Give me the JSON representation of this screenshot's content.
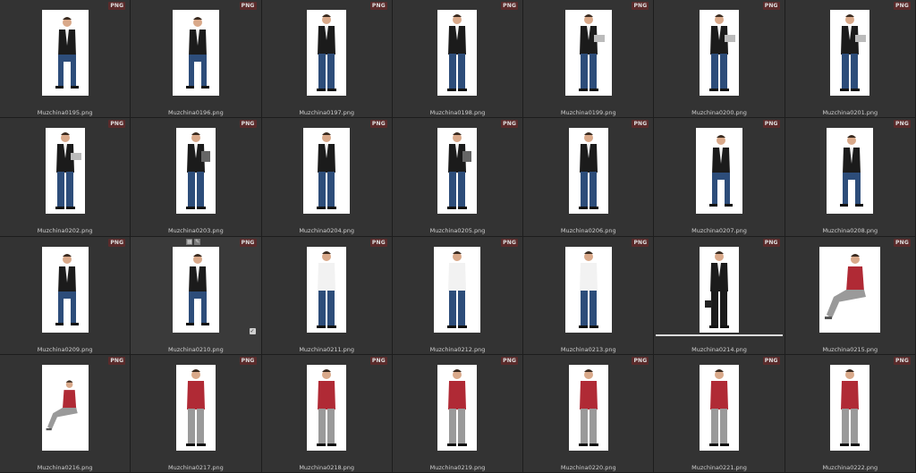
{
  "badge_label": "PNG",
  "colors": {
    "background": "#2b2b2b",
    "cell": "#333333",
    "badge": "#5a2b2b",
    "thumb_bg": "#ffffff"
  },
  "items": [
    {
      "name": "Muzchina0195.png",
      "pose": "sit-front"
    },
    {
      "name": "Muzchina0196.png",
      "pose": "sit-side"
    },
    {
      "name": "Muzchina0197.png",
      "pose": "back-sit"
    },
    {
      "name": "Muzchina0198.png",
      "pose": "back-stand"
    },
    {
      "name": "Muzchina0199.png",
      "pose": "walk-laptop"
    },
    {
      "name": "Muzchina0200.png",
      "pose": "stand-laptop"
    },
    {
      "name": "Muzchina0201.png",
      "pose": "stand-laptop"
    },
    {
      "name": "Muzchina0202.png",
      "pose": "stand-laptop"
    },
    {
      "name": "Muzchina0203.png",
      "pose": "stand-folder"
    },
    {
      "name": "Muzchina0204.png",
      "pose": "stand-point"
    },
    {
      "name": "Muzchina0205.png",
      "pose": "stand-folder"
    },
    {
      "name": "Muzchina0206.png",
      "pose": "stand-phone"
    },
    {
      "name": "Muzchina0207.png",
      "pose": "sit-laptop"
    },
    {
      "name": "Muzchina0208.png",
      "pose": "sit-side"
    },
    {
      "name": "Muzchina0209.png",
      "pose": "sit-front"
    },
    {
      "name": "Muzchina0210.png",
      "pose": "sit-side",
      "selected": true
    },
    {
      "name": "Muzchina0211.png",
      "pose": "walk-shirt"
    },
    {
      "name": "Muzchina0212.png",
      "pose": "wave-shirt"
    },
    {
      "name": "Muzchina0213.png",
      "pose": "wave-shirt"
    },
    {
      "name": "Muzchina0214.png",
      "pose": "phone-bag",
      "dark": true,
      "progress": true
    },
    {
      "name": "Muzchina0215.png",
      "pose": "sit-casual"
    },
    {
      "name": "Muzchina0216.png",
      "pose": "casual-sit"
    },
    {
      "name": "Muzchina0217.png",
      "pose": "casual-drink"
    },
    {
      "name": "Muzchina0218.png",
      "pose": "casual-stand"
    },
    {
      "name": "Muzchina0219.png",
      "pose": "casual-stand"
    },
    {
      "name": "Muzchina0220.png",
      "pose": "casual-phone"
    },
    {
      "name": "Muzchina0221.png",
      "pose": "casual-walk"
    },
    {
      "name": "Muzchina0222.png",
      "pose": "casual-stand"
    }
  ]
}
